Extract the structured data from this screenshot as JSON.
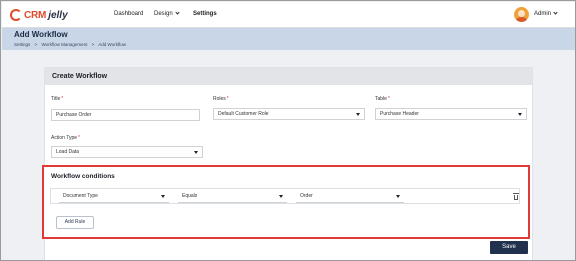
{
  "brand": {
    "name_part1": "CRM",
    "name_part2": "jelly"
  },
  "nav": {
    "dashboard": "Dashboard",
    "design": "Design",
    "settings": "Settings"
  },
  "user": {
    "name": "Admin"
  },
  "header": {
    "title": "Add Workflow",
    "breadcrumb": [
      "Settings",
      "Workflow Management",
      "Add Workflow"
    ],
    "separator": ">"
  },
  "form": {
    "card_title": "Create Workflow",
    "title_label": "Title",
    "title_value": "Purchase Order",
    "roles_label": "Roles",
    "roles_value": "Default Customer Role",
    "table_label": "Table",
    "table_value": "Purchase Header",
    "action_type_label": "Action Type",
    "action_type_value": "Load Data",
    "required_mark": "*"
  },
  "conditions": {
    "title": "Workflow conditions",
    "rows": [
      {
        "field": "Document Type",
        "operator": "Equals",
        "value": "Order"
      }
    ],
    "add_rule_label": "Add Rule"
  },
  "actions": {
    "save_label": "Save"
  },
  "colors": {
    "brand": "#e04a2a",
    "header_band": "#c8d6e7",
    "highlight": "#e03a36",
    "primary_button": "#21304d"
  }
}
